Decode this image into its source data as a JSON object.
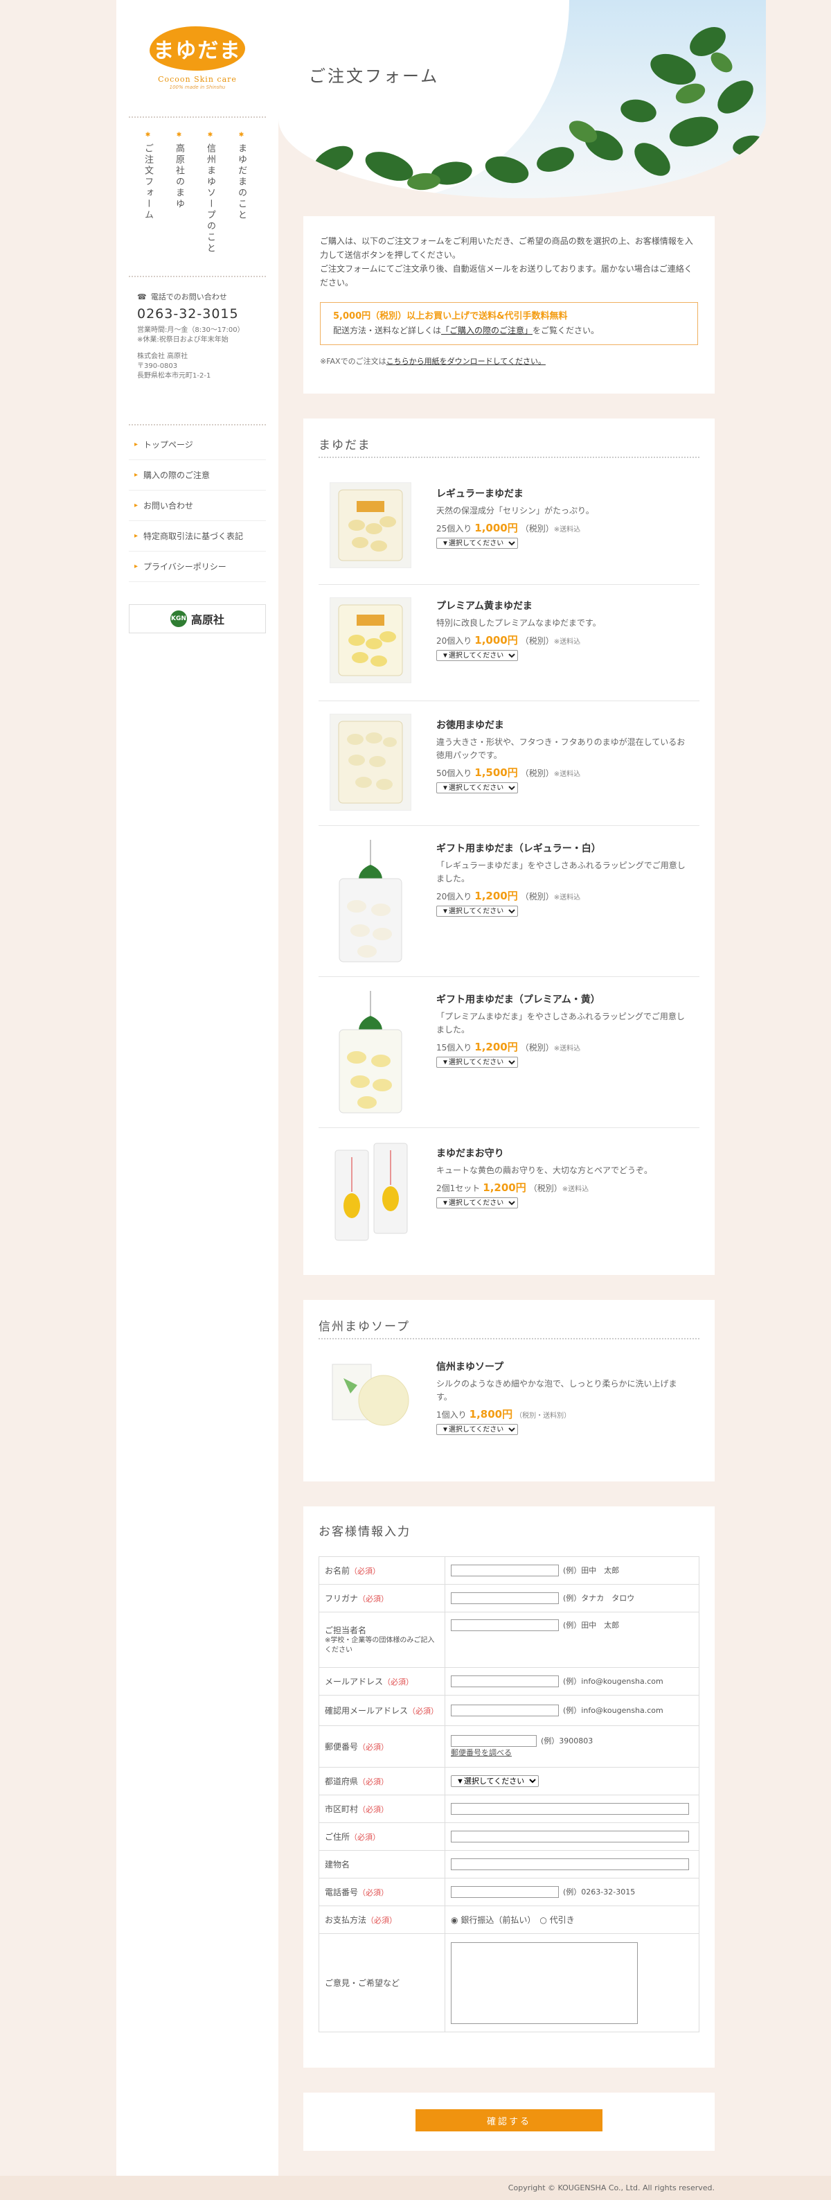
{
  "logo": {
    "text": "まゆだま",
    "sub": "Cocoon Skin care",
    "sub2": "100% made in Shinshu"
  },
  "hero": {
    "title": "ご注文フォーム"
  },
  "vnav": [
    "まゆだまのこと",
    "信州まゆソープのこと",
    "高原社のまゆ",
    "ご注文フォーム"
  ],
  "contact": {
    "label": "電話でのお問い合わせ",
    "tel": "0263-32-3015",
    "hours": "営業時間:月〜金（8:30〜17:00）",
    "holiday": "※休業:祝祭日および年末年始",
    "company": "株式会社 高原社",
    "zip": "〒390-0803",
    "address": "長野県松本市元町1-2-1"
  },
  "side_nav": [
    "トップページ",
    "購入の際のご注意",
    "お問い合わせ",
    "特定商取引法に基づく表記",
    "プライバシーポリシー"
  ],
  "banner": {
    "seal": "KGN",
    "text": "高原社"
  },
  "intro": {
    "p1": "ご購入は、以下のご注文フォームをご利用いただき、ご希望の商品の数を選択の上、お客様情報を入力して送信ボタンを押してください。",
    "p2": "ご注文フォームにてご注文承り後、自動返信メールをお送りしております。届かない場合はご連絡ください。",
    "notice_big": "5,000円（税別）以上お買い上げで送料&代引手数料無料",
    "notice_pre": "配送方法・送料など詳しくは",
    "notice_link": "「ご購入の際のご注意」",
    "notice_post": "をご覧ください。",
    "fax_pre": "※FAXでのご注文は",
    "fax_link": "こちらから用紙をダウンロードしてください。"
  },
  "section_mayudama": {
    "title": "まゆだま"
  },
  "products": [
    {
      "name": "レギュラーまゆだま",
      "desc": "天然の保湿成分「セリシン」がたっぷり。",
      "qty": "25個入り",
      "price": "1,000円",
      "tax": "（税別）",
      "ship": "※送料込",
      "select": "▼選択してください"
    },
    {
      "name": "プレミアム黄まゆだま",
      "desc": "特別に改良したプレミアムなまゆだまです。",
      "qty": "20個入り",
      "price": "1,000円",
      "tax": "（税別）",
      "ship": "※送料込",
      "select": "▼選択してください"
    },
    {
      "name": "お徳用まゆだま",
      "desc": "違う大きさ・形状や、フタつき・フタありのまゆが混在しているお徳用パックです。",
      "qty": "50個入り",
      "price": "1,500円",
      "tax": "（税別）",
      "ship": "※送料込",
      "select": "▼選択してください"
    },
    {
      "name": "ギフト用まゆだま（レギュラー・白）",
      "desc": "「レギュラーまゆだま」をやさしさあふれるラッピングでご用意しました。",
      "qty": "20個入り",
      "price": "1,200円",
      "tax": "（税別）",
      "ship": "※送料込",
      "select": "▼選択してください"
    },
    {
      "name": "ギフト用まゆだま（プレミアム・黄）",
      "desc": "「プレミアムまゆだま」をやさしさあふれるラッピングでご用意しました。",
      "qty": "15個入り",
      "price": "1,200円",
      "tax": "（税別）",
      "ship": "※送料込",
      "select": "▼選択してください"
    },
    {
      "name": "まゆだまお守り",
      "desc": "キュートな黄色の繭お守りを、大切な方とペアでどうぞ。",
      "qty": "2個1セット",
      "price": "1,200円",
      "tax": "（税別）",
      "ship": "※送料込",
      "select": "▼選択してください"
    }
  ],
  "section_soap": {
    "title": "信州まゆソープ"
  },
  "soap": {
    "name": "信州まゆソープ",
    "desc": "シルクのようなきめ細やかな泡で、しっとり柔らかに洗い上げます。",
    "qty": "1個入り",
    "price": "1,800円",
    "tax": "（税別・送料別）",
    "select": "▼選択してください"
  },
  "section_customer": {
    "title": "お客様情報入力"
  },
  "form": {
    "name": {
      "label": "お名前",
      "req": "（必須）",
      "ex": "(例）田中　太郎"
    },
    "kana": {
      "label": "フリガナ",
      "req": "（必須）",
      "ex": "(例）タナカ　タロウ"
    },
    "person": {
      "label": "ご担当者名",
      "note": "※学校・企業等の団体様のみご記入ください",
      "ex": "(例）田中　太郎"
    },
    "email": {
      "label": "メールアドレス",
      "req": "（必須）",
      "ex": "(例）info@kougensha.com"
    },
    "email2": {
      "label": "確認用メールアドレス",
      "req": "（必須）",
      "ex": "(例）info@kougensha.com"
    },
    "zip": {
      "label": "郵便番号",
      "req": "（必須）",
      "ex": "(例）3900803",
      "link": "郵便番号を調べる"
    },
    "pref": {
      "label": "都道府県",
      "req": "（必須）",
      "select": "▼選択してください"
    },
    "city": {
      "label": "市区町村",
      "req": "（必須）"
    },
    "addr": {
      "label": "ご住所",
      "req": "（必須）"
    },
    "bldg": {
      "label": "建物名"
    },
    "tel": {
      "label": "電話番号",
      "req": "（必須）",
      "ex": "(例）0263-32-3015"
    },
    "pay": {
      "label": "お支払方法",
      "req": "（必須）",
      "opt1": "銀行振込（前払い）",
      "opt2": "代引き"
    },
    "msg": {
      "label": "ご意見・ご希望など"
    }
  },
  "submit": "確認する",
  "footer": "Copyright © KOUGENSHA Co., Ltd. All rights reserved.",
  "colors": {
    "accent": "#f39c12",
    "bg": "#f8efe9"
  }
}
